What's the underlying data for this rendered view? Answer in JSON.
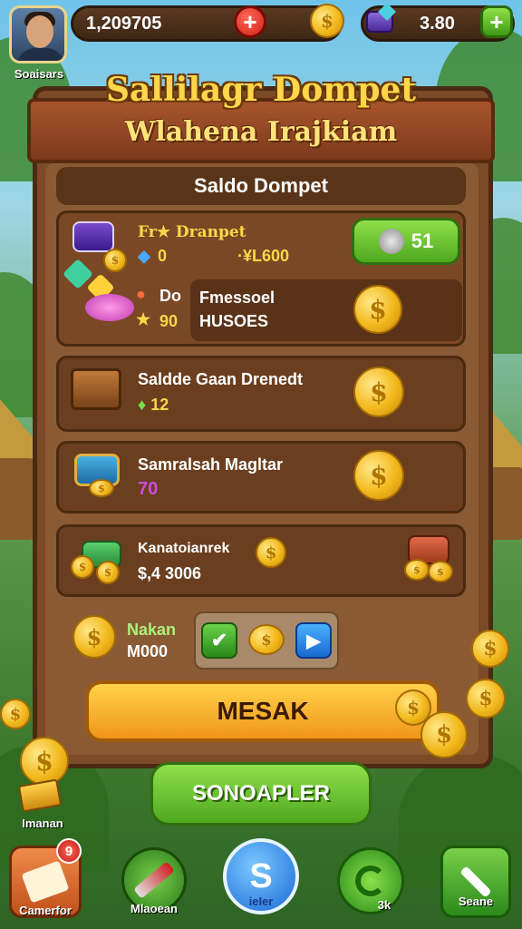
{
  "player": {
    "name": "Soaisars"
  },
  "currency": {
    "coins": "1,209705",
    "gems": "3.80"
  },
  "title": {
    "line1": "Sallilagr Dompet",
    "line2": "Wlahena Irajkiam"
  },
  "panel": {
    "header": "Saldo Dompet",
    "rows": [
      {
        "title": "Fr★ Dranpet",
        "val1": "0",
        "val2": "·¥L600",
        "btn": "51"
      },
      {
        "title": "Do",
        "val1": "90",
        "detail1": "Fmessoel",
        "detail2": "HUSOES"
      },
      {
        "title": "Saldde Gaan Drenedt",
        "val": "12"
      },
      {
        "title": "Samralsah Magltar",
        "val": "70"
      },
      {
        "title": "Kanatoianrek",
        "val": "$,4 3006"
      }
    ],
    "bottom_left": {
      "label": "Nakan",
      "value": "M000"
    },
    "primary_button": "MESAK"
  },
  "secondary_button": "SONOAPLER",
  "side_label": "Imanan",
  "nav": [
    {
      "label": "Camerfor",
      "badge": "9"
    },
    {
      "label": "Mlaoean"
    },
    {
      "label": "ieIer",
      "glyph": "S"
    },
    {
      "label": "3k"
    },
    {
      "label": "Seane"
    }
  ],
  "colors": {
    "panel": "#7b4a26",
    "gold": "#ffd64a",
    "green": "#5bb82a",
    "orange": "#f5a623"
  }
}
